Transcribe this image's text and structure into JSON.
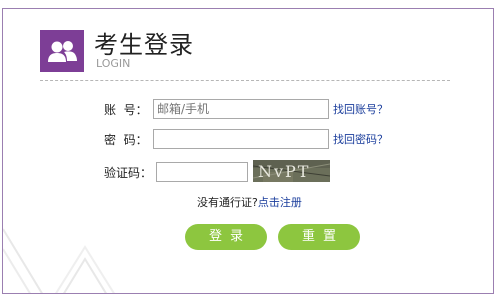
{
  "header": {
    "title": "考生登录",
    "subtitle": "LOGIN",
    "logo_icon": "users-icon"
  },
  "form": {
    "account_label": "账  号：",
    "account_placeholder": "邮箱/手机",
    "account_link": "找回账号？",
    "password_label": "密  码：",
    "password_link": "找回密码？",
    "captcha_label": "验证码：",
    "captcha_text": "NvPT"
  },
  "hint": {
    "plain": "没有通行证?",
    "register_link": "点击注册"
  },
  "buttons": {
    "login": "登录",
    "reset": "重置"
  },
  "colors": {
    "brand": "#7d3e96",
    "button": "#8dc63f",
    "link": "#1a3d9c"
  }
}
